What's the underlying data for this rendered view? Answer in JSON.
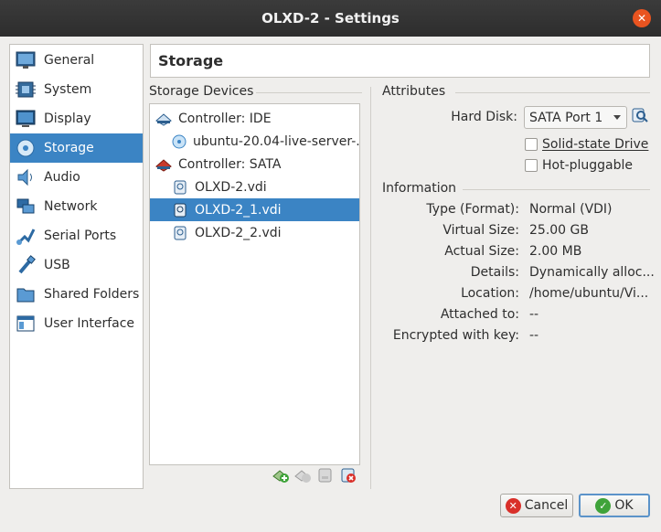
{
  "window": {
    "title": "OLXD-2 - Settings"
  },
  "sidebar": {
    "items": [
      {
        "label": "General",
        "icon": "general-icon"
      },
      {
        "label": "System",
        "icon": "system-icon"
      },
      {
        "label": "Display",
        "icon": "display-icon"
      },
      {
        "label": "Storage",
        "icon": "storage-icon",
        "selected": true
      },
      {
        "label": "Audio",
        "icon": "audio-icon"
      },
      {
        "label": "Network",
        "icon": "network-icon"
      },
      {
        "label": "Serial Ports",
        "icon": "serial-ports-icon"
      },
      {
        "label": "USB",
        "icon": "usb-icon"
      },
      {
        "label": "Shared Folders",
        "icon": "shared-folders-icon"
      },
      {
        "label": "User Interface",
        "icon": "user-interface-icon"
      }
    ]
  },
  "page": {
    "title": "Storage"
  },
  "storage_devices": {
    "title": "Storage Devices",
    "tree": [
      {
        "label": "Controller: IDE",
        "type": "controller"
      },
      {
        "label": "ubuntu-20.04-live-server-...",
        "type": "optical"
      },
      {
        "label": "Controller: SATA",
        "type": "controller"
      },
      {
        "label": "OLXD-2.vdi",
        "type": "disk"
      },
      {
        "label": "OLXD-2_1.vdi",
        "type": "disk",
        "selected": true
      },
      {
        "label": "OLXD-2_2.vdi",
        "type": "disk"
      }
    ],
    "toolbar": [
      "add-attachment-icon",
      "remove-attachment-icon",
      "add-controller-icon",
      "remove-controller-icon"
    ]
  },
  "attributes": {
    "title": "Attributes",
    "hard_disk_label": "Hard Disk:",
    "hard_disk_value": "SATA Port 1",
    "solid_state_label": "Solid-state Drive",
    "solid_state_checked": false,
    "hot_pluggable_label": "Hot-pluggable",
    "hot_pluggable_checked": false
  },
  "information": {
    "title": "Information",
    "rows": [
      {
        "label": "Type (Format):",
        "value": "Normal (VDI)"
      },
      {
        "label": "Virtual Size:",
        "value": "25.00 GB"
      },
      {
        "label": "Actual Size:",
        "value": "2.00 MB"
      },
      {
        "label": "Details:",
        "value": "Dynamically alloc..."
      },
      {
        "label": "Location:",
        "value": "/home/ubuntu/Vi..."
      },
      {
        "label": "Attached to:",
        "value": "--"
      },
      {
        "label": "Encrypted with key:",
        "value": "--"
      }
    ]
  },
  "buttons": {
    "cancel": "Cancel",
    "ok": "OK"
  },
  "colors": {
    "selection": "#3b84c4",
    "titlebar": "#2d2d2d",
    "close": "#e95420"
  }
}
